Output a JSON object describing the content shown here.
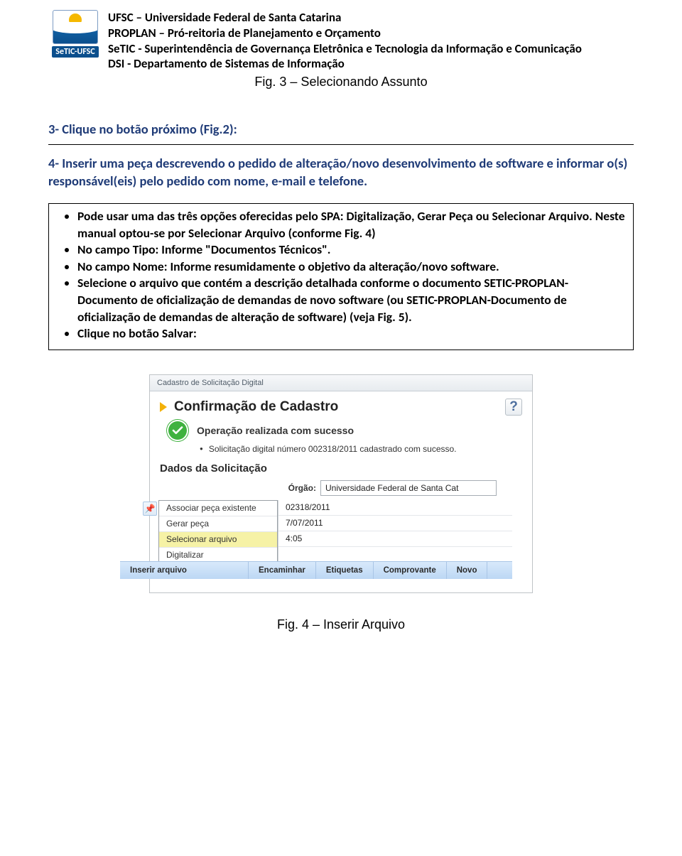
{
  "logo_label": "SeTIC-UFSC",
  "header": {
    "l1": "UFSC – Universidade Federal de Santa Catarina",
    "l2": "PROPLAN – Pró-reitoria de Planejamento e Orçamento",
    "l3": "SeTIC - Superintendência de Governança Eletrônica e Tecnologia da Informação e Comunicação",
    "l4": "DSI - Departamento de Sistemas de Informação"
  },
  "fig3": "Fig. 3 – Selecionando Assunto",
  "step3": "3- Clique no botão próximo (Fig.2):",
  "step4": "4- Inserir uma peça descrevendo o pedido de alteração/novo desenvolvimento de software e informar o(s) responsável(eis) pelo pedido com nome, e-mail e telefone.",
  "box": {
    "intro1": "Pode usar uma das três opções oferecidas pelo SPA: Digitalização, Gerar Peça ou Selecionar Arquivo. Neste manual optou-se por Selecionar Arquivo (conforme Fig. 4)",
    "b1": "No campo Tipo: Informe \"Documentos Técnicos\".",
    "b2": "No campo Nome: Informe resumidamente o objetivo da alteração/novo software.",
    "b3": "Selecione o arquivo que contém a descrição detalhada conforme o documento SETIC-PROPLAN-Documento de oficialização de demandas de novo software (ou SETIC-PROPLAN-Documento de oficialização de demandas de alteração de software) (veja Fig. 5).",
    "b4": "Clique no botão Salvar:"
  },
  "shot": {
    "breadcrumb": "Cadastro de Solicitação Digital",
    "title": "Confirmação de Cadastro",
    "help": "?",
    "success_title": "Operação realizada com sucesso",
    "success_msg": "Solicitação digital número 002318/2011 cadastrado com sucesso.",
    "section": "Dados da Solicitação",
    "orgao_label": "Órgão:",
    "orgao_value": "Universidade Federal de Santa Cat",
    "ctx": {
      "i1": "Associar peça existente",
      "i2": "Gerar peça",
      "i3": "Selecionar arquivo",
      "i4": "Digitalizar"
    },
    "stub": {
      "s1": "02318/2011",
      "s2": "7/07/2011",
      "s3": "4:05"
    },
    "toolbar": {
      "t0": "Inserir arquivo",
      "t1": "Encaminhar",
      "t2": "Etiquetas",
      "t3": "Comprovante",
      "t4": "Novo"
    }
  },
  "fig4": "Fig. 4 – Inserir Arquivo"
}
